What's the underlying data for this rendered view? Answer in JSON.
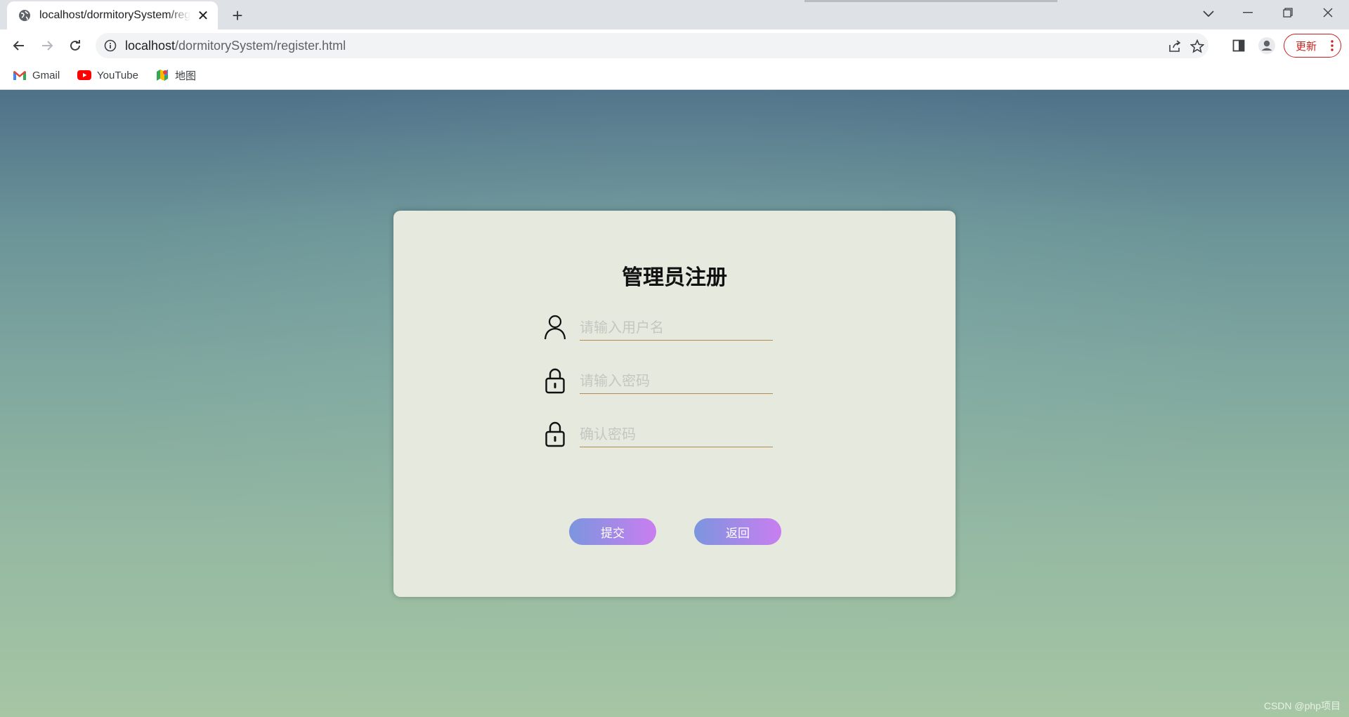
{
  "browser": {
    "tab": {
      "title": "localhost/dormitorySystem/register.html",
      "close_glyph": "✕",
      "favicon": "globe-icon"
    },
    "new_tab_glyph": "+",
    "address": {
      "host": "localhost",
      "path": "/dormitorySystem/register.html"
    },
    "update_label": "更新",
    "bookmarks": [
      {
        "label": "Gmail",
        "icon": "gmail-icon"
      },
      {
        "label": "YouTube",
        "icon": "youtube-icon"
      },
      {
        "label": "地图",
        "icon": "maps-icon"
      }
    ]
  },
  "page": {
    "title": "管理员注册",
    "fields": {
      "username": {
        "placeholder": "请输入用户名",
        "value": "",
        "icon": "user-icon"
      },
      "password": {
        "placeholder": "请输入密码",
        "value": "",
        "icon": "lock-icon"
      },
      "confirm": {
        "placeholder": "确认密码",
        "value": "",
        "icon": "lock-icon"
      }
    },
    "buttons": {
      "submit": "提交",
      "back": "返回"
    },
    "watermark": "CSDN @php项目"
  },
  "colors": {
    "button_gradient_start": "#7c95de",
    "button_gradient_end": "#c97ef0",
    "card_background": "#e6e9de",
    "field_underline": "#b48a4e",
    "update_red": "#c5221f"
  }
}
